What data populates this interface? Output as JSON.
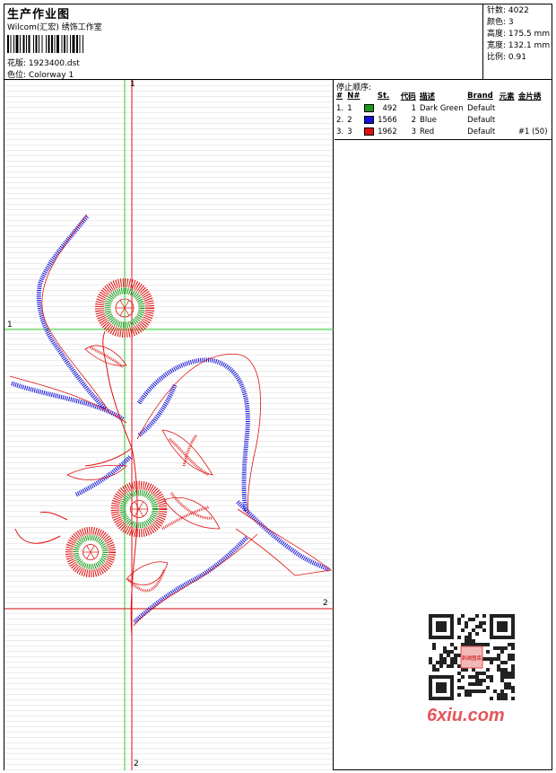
{
  "header": {
    "title": "生产作业图",
    "company": "Wilcom(汇宏) 绣饰工作室",
    "design_label": "花版:",
    "design_value": "1923400.dst",
    "colorway_label": "色位:",
    "colorway_value": "Colorway 1"
  },
  "stats": {
    "stitches_label": "针数:",
    "stitches_value": "4022",
    "colors_label": "颜色:",
    "colors_value": "3",
    "height_label": "高度:",
    "height_value": "175.5 mm",
    "width_label": "宽度:",
    "width_value": "132.1 mm",
    "scale_label": "比例:",
    "scale_value": "0.91"
  },
  "stop_sequence": {
    "title": "停止顺序:",
    "headers": [
      "#",
      "N#",
      "St.",
      "代码",
      "描述",
      "Brand",
      "元素",
      "金片绣"
    ],
    "rows": [
      {
        "num": "1.",
        "n": "1",
        "color": "#1a9a1a",
        "st": "492",
        "code": "1",
        "desc": "Dark Green",
        "brand": "Default",
        "element": "",
        "sequin": ""
      },
      {
        "num": "2.",
        "n": "2",
        "color": "#1212d8",
        "st": "1566",
        "code": "2",
        "desc": "Blue",
        "brand": "Default",
        "element": "",
        "sequin": ""
      },
      {
        "num": "3.",
        "n": "3",
        "color": "#e01010",
        "st": "1962",
        "code": "3",
        "desc": "Red",
        "brand": "Default",
        "element": "",
        "sequin": "#1 (50)"
      }
    ]
  },
  "guides": {
    "top_marker": "1",
    "left_marker": "1",
    "right_marker": "2",
    "bottom_marker": "2"
  },
  "watermark": "6xiu.com",
  "qr_badge": "刺绣图库"
}
